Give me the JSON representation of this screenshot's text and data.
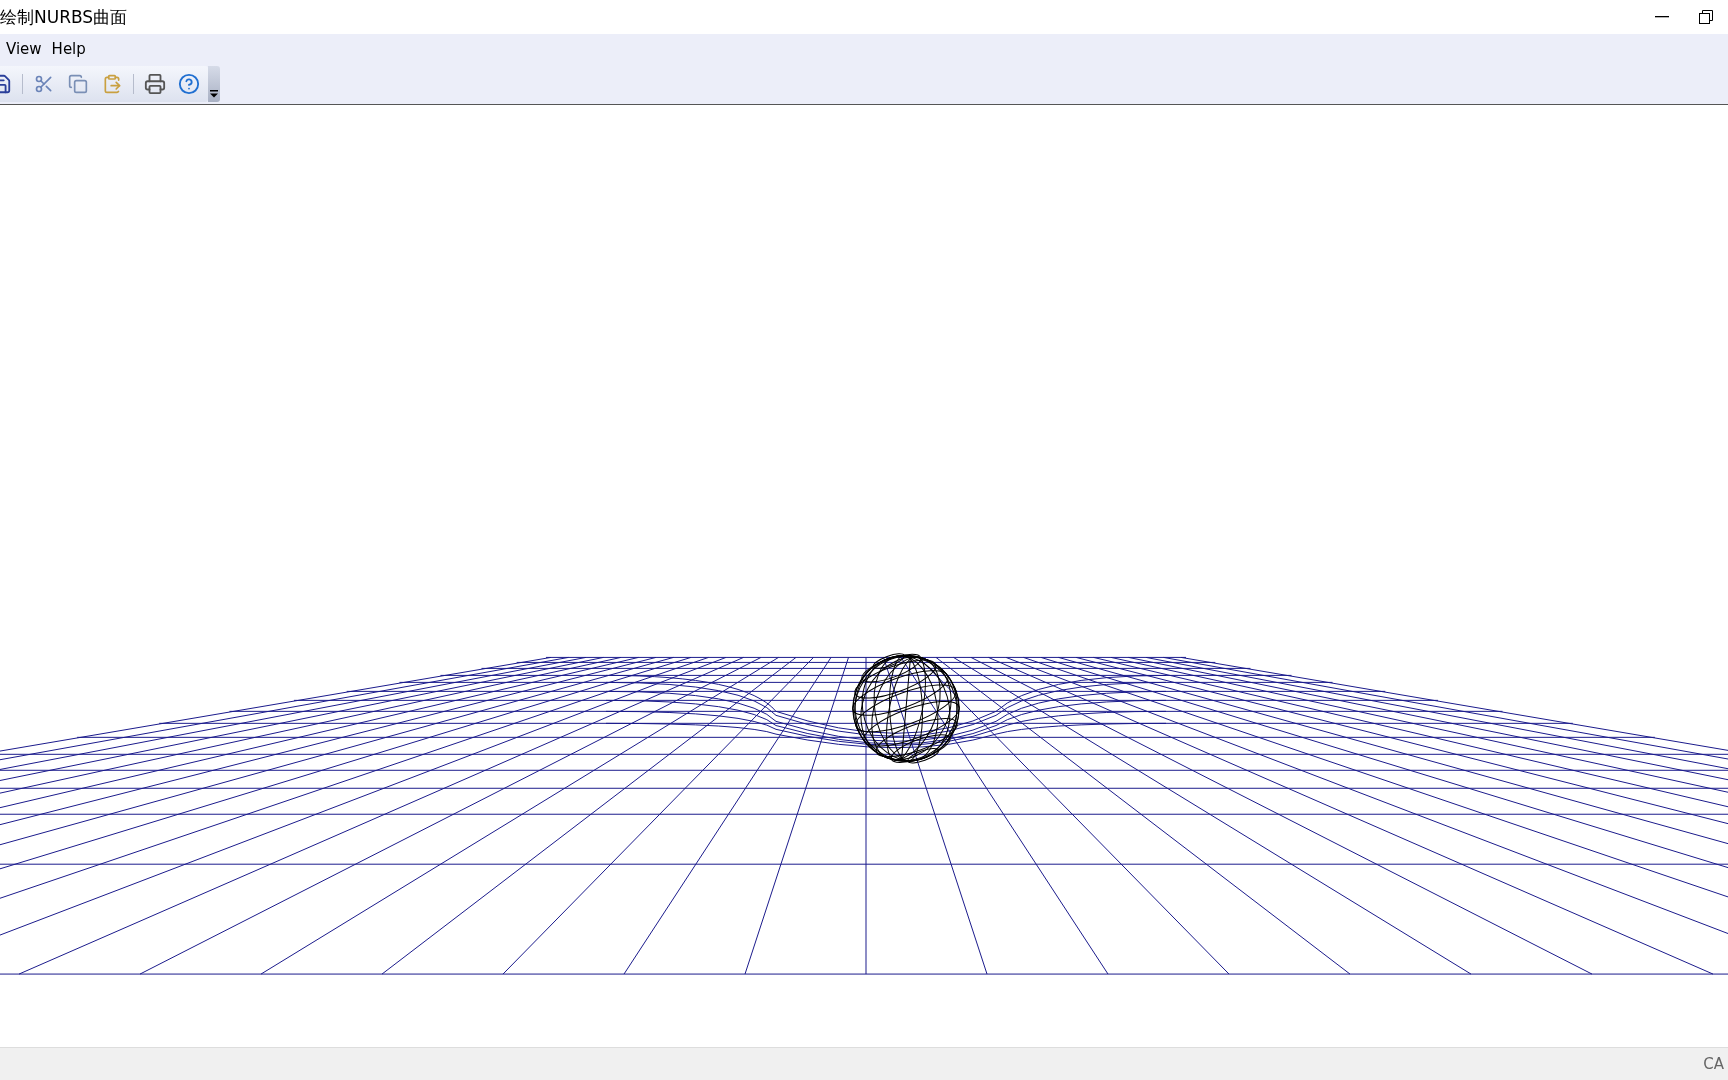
{
  "window": {
    "title": "绘制NURBS曲面"
  },
  "menu": [
    "View",
    "Help"
  ],
  "toolbar": [
    {
      "kind": "save"
    },
    {
      "kind": "separator"
    },
    {
      "kind": "cut"
    },
    {
      "kind": "copy"
    },
    {
      "kind": "paste"
    },
    {
      "kind": "separator"
    },
    {
      "kind": "print"
    },
    {
      "kind": "help"
    }
  ],
  "status_bar": {
    "indicator": "CA"
  }
}
